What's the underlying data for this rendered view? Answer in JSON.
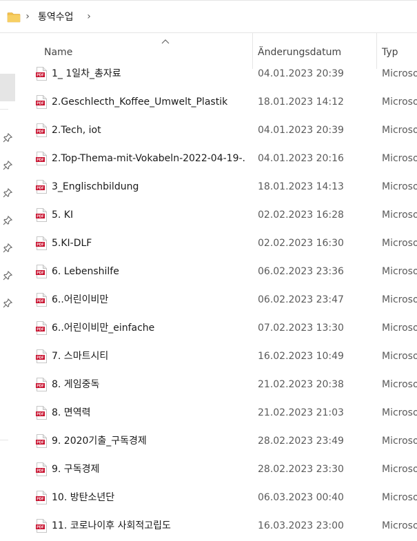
{
  "breadcrumb": {
    "items": [
      "통역수업"
    ]
  },
  "columns": {
    "name": "Name",
    "date": "Änderungsdatum",
    "type": "Typ"
  },
  "sort": {
    "column": "name",
    "direction": "ascending"
  },
  "colors": {
    "pdf_red": "#c8102e",
    "folder_yellow": "#f2c14e",
    "selection": "#e5e5e5"
  },
  "files": [
    {
      "name": "1_ 1일차_총자료",
      "date": "04.01.2023 20:39",
      "type": "Microsoft"
    },
    {
      "name": "2.Geschlecth_Koffee_Umwelt_Plastik",
      "date": "18.01.2023 14:12",
      "type": "Microsoft"
    },
    {
      "name": "2.Tech, iot",
      "date": "04.01.2023 20:39",
      "type": "Microsoft"
    },
    {
      "name": "2.Top-Thema-mit-Vokabeln-2022-04-19-...",
      "date": "04.01.2023 20:16",
      "type": "Microsoft"
    },
    {
      "name": "3_Englischbildung",
      "date": "18.01.2023 14:13",
      "type": "Microsoft"
    },
    {
      "name": "5. KI",
      "date": "02.02.2023 16:28",
      "type": "Microsoft"
    },
    {
      "name": "5.KI-DLF",
      "date": "02.02.2023 16:30",
      "type": "Microsoft"
    },
    {
      "name": "6. Lebenshilfe",
      "date": "06.02.2023 23:36",
      "type": "Microsoft"
    },
    {
      "name": "6..어린이비만",
      "date": "06.02.2023 23:47",
      "type": "Microsoft"
    },
    {
      "name": "6..어린이비만_einfache",
      "date": "07.02.2023 13:30",
      "type": "Microsoft"
    },
    {
      "name": "7. 스마트시티",
      "date": "16.02.2023 10:49",
      "type": "Microsoft"
    },
    {
      "name": "8. 게임중독",
      "date": "21.02.2023 20:38",
      "type": "Microsoft"
    },
    {
      "name": "8. 면역력",
      "date": "21.02.2023 21:03",
      "type": "Microsoft"
    },
    {
      "name": "9. 2020기출_구독경제",
      "date": "28.02.2023 23:49",
      "type": "Microsoft"
    },
    {
      "name": "9. 구독경제",
      "date": "28.02.2023 23:30",
      "type": "Microsoft"
    },
    {
      "name": "10. 방탄소년단",
      "date": "06.03.2023 00:40",
      "type": "Microsoft"
    },
    {
      "name": "11. 코로나이후 사회적고립도",
      "date": "16.03.2023 23:00",
      "type": "Microsoft"
    }
  ]
}
